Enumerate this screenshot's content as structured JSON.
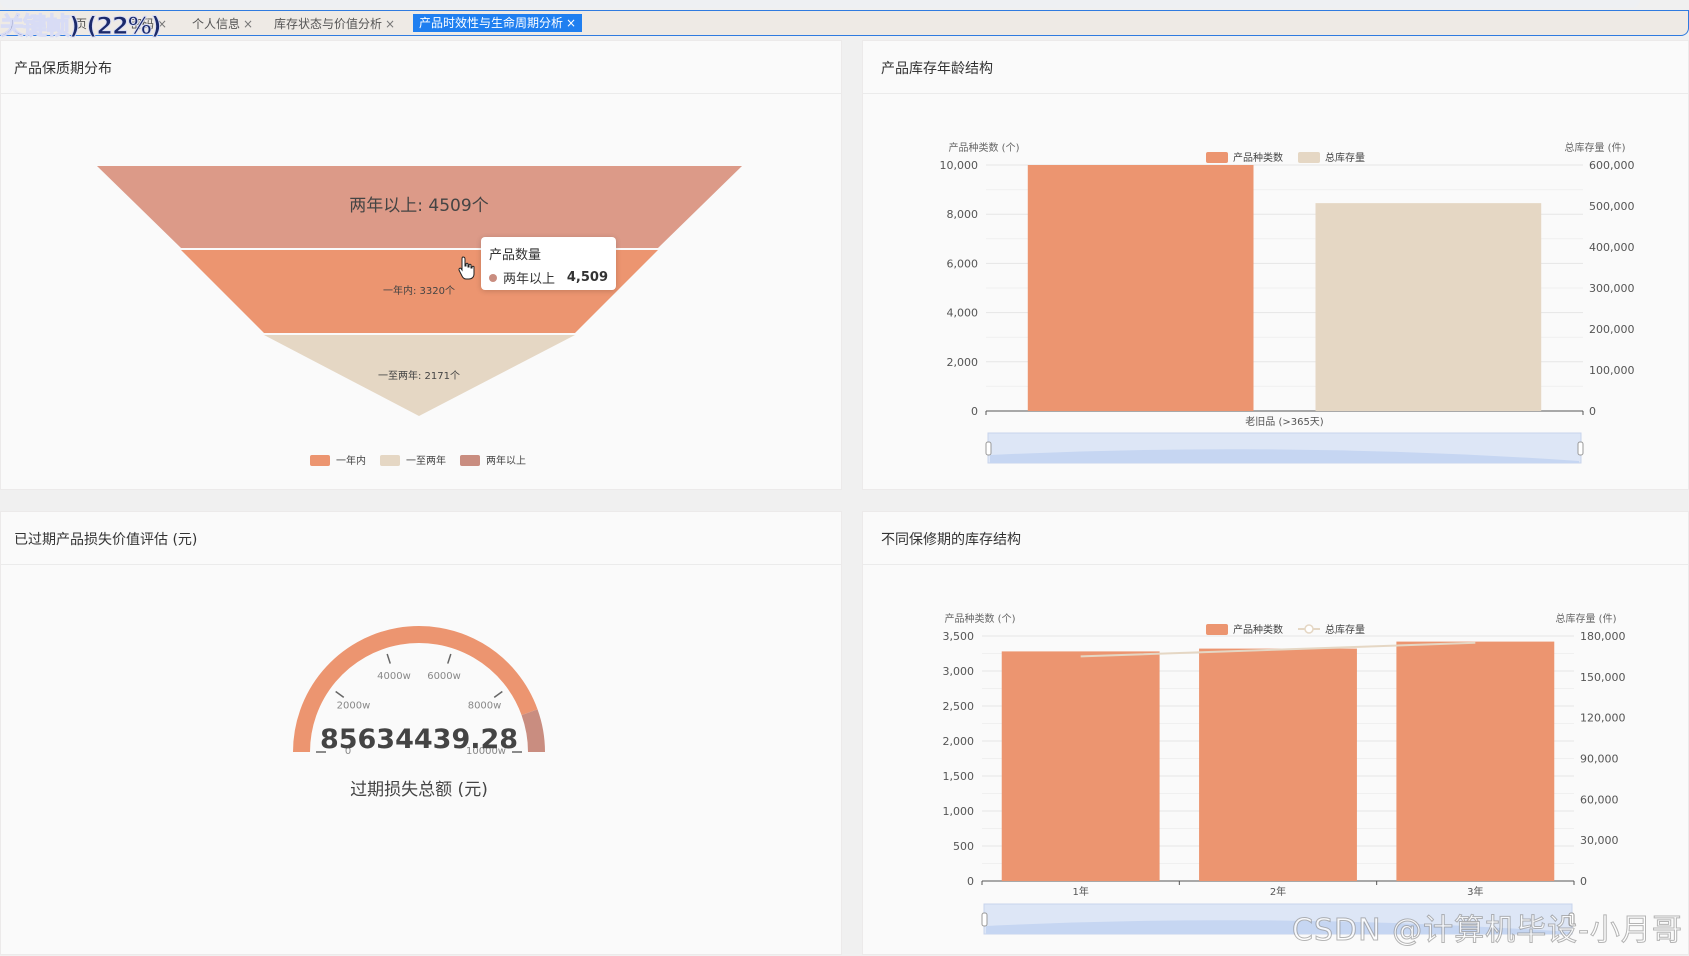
{
  "overlay_text": "关键帧) (22%)",
  "tabs": [
    {
      "label": "页",
      "active": false
    },
    {
      "label": "密码",
      "active": false
    },
    {
      "label": "个人信息",
      "active": false
    },
    {
      "label": "库存状态与价值分析",
      "active": false
    },
    {
      "label": "产品时效性与生命周期分析",
      "active": true
    }
  ],
  "close_glyph": "×",
  "panels": {
    "shelf_life": {
      "title": "产品保质期分布",
      "funnel": {
        "type": "funnel",
        "segments": [
          {
            "name": "两年以上",
            "value": 4509,
            "label": "两年以上: 4509个",
            "color": "#dc9a88"
          },
          {
            "name": "一年内",
            "value": 3320,
            "label": "一年内: 3320个",
            "color": "#ec9570"
          },
          {
            "name": "一至两年",
            "value": 2171,
            "label": "一至两年: 2171个",
            "color": "#e5d7c4"
          }
        ],
        "legend": [
          {
            "name": "一年内",
            "color": "#ec9570"
          },
          {
            "name": "一至两年",
            "color": "#e5d7c4"
          },
          {
            "name": "两年以上",
            "color": "#c98d80"
          }
        ]
      },
      "tooltip": {
        "title": "产品数量",
        "series": "两年以上",
        "value": "4,509",
        "color": "#c98d80"
      }
    },
    "age": {
      "title": "产品库存年龄结构",
      "chart_data": {
        "type": "bar",
        "categories": [
          "老旧品 (>365天)"
        ],
        "series": [
          {
            "name": "产品种类数",
            "axis": "left",
            "values": [
              10000
            ],
            "color": "#ec9570"
          },
          {
            "name": "总库存量",
            "axis": "right",
            "values": [
              507000
            ],
            "color": "#e5d7c4"
          }
        ],
        "ylabel": "产品种类数 (个)",
        "ylabel_right": "总库存量 (件)",
        "ylim": [
          0,
          10000
        ],
        "ylim_right": [
          0,
          600000
        ],
        "yticks": [
          "0",
          "2,000",
          "4,000",
          "6,000",
          "8,000",
          "10,000"
        ],
        "yticks_right": [
          "0",
          "100,000",
          "200,000",
          "300,000",
          "400,000",
          "500,000",
          "600,000"
        ],
        "legend_position": "top-center",
        "grid": true
      }
    },
    "expired": {
      "title": "已过期产品损失价值评估 (元)",
      "gauge": {
        "value": "85634439.28",
        "value_fraction": 0.89,
        "caption": "过期损失总额 (元)",
        "tick_labels": [
          "0",
          "2000w",
          "4000w",
          "6000w",
          "8000w",
          "10000w"
        ],
        "color_fill": "#ec9570",
        "color_rest": "#c98d80"
      }
    },
    "warranty": {
      "title": "不同保修期的库存结构",
      "chart_data": {
        "type": "bar",
        "categories": [
          "1年",
          "2年",
          "3年"
        ],
        "series": [
          {
            "name": "产品种类数",
            "axis": "left",
            "kind": "bar",
            "values": [
              3280,
              3320,
              3420
            ],
            "color": "#ec9570"
          },
          {
            "name": "总库存量",
            "axis": "right",
            "kind": "line",
            "values": [
              165000,
              170000,
              175000
            ],
            "color": "#e5d7c4"
          }
        ],
        "ylabel": "产品种类数 (个)",
        "ylabel_right": "总库存量 (件)",
        "ylim": [
          0,
          3500
        ],
        "ylim_right": [
          0,
          180000
        ],
        "yticks": [
          "0",
          "500",
          "1,000",
          "1,500",
          "2,000",
          "2,500",
          "3,000",
          "3,500"
        ],
        "yticks_right": [
          "0",
          "30,000",
          "60,000",
          "90,000",
          "120,000",
          "150,000",
          "180,000"
        ],
        "legend_position": "top-center",
        "grid": true
      }
    }
  },
  "watermark": "CSDN @计算机毕设-小月哥"
}
